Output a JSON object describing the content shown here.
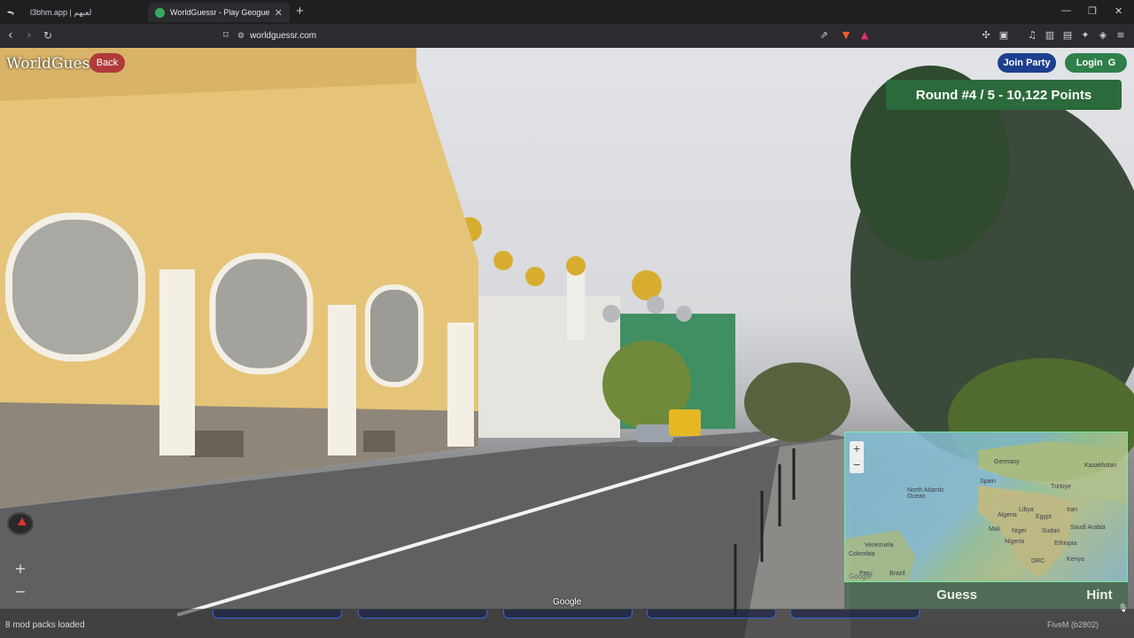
{
  "browser": {
    "tabs": [
      {
        "title": "l3bhm.app | لعبهم",
        "active": false
      },
      {
        "title": "WorldGuessr - Play Geoguessr fr",
        "active": true
      }
    ],
    "url": "worldguessr.com",
    "window_controls": [
      "—",
      "❐",
      "✕"
    ]
  },
  "game": {
    "logo": "WorldGuessr",
    "back_label": "Back",
    "join_party_label": "Join Party",
    "login_label": "Login",
    "login_icon": "G",
    "round_banner": "Round #4 / 5 - 10,122 Points",
    "guess_label": "Guess",
    "hint_label": "Hint",
    "streetview_zoom_in": "+",
    "streetview_zoom_out": "−",
    "map_zoom_in": "+",
    "map_zoom_out": "−",
    "google_watermark": "Google",
    "map_google_watermark": "Google",
    "map_labels": [
      "Germany",
      "Kazakhstan",
      "Spain",
      "Türkiye",
      "North Atlantic Ocean",
      "Egypt",
      "Iran",
      "Algeria",
      "Libya",
      "Saudi Arabia",
      "Mali",
      "Niger",
      "Sudan",
      "Nigeria",
      "Ethiopia",
      "Venezuela",
      "Colombia",
      "DRC",
      "Kenya",
      "Brazil",
      "Peru"
    ]
  },
  "footer": {
    "mod_packs": "8 mod packs loaded",
    "fivem": "FiveM (b2802)"
  },
  "colors": {
    "back_button": "#b03a3a",
    "join_party_button": "#1c3f8f",
    "login_button": "#2f7f4b",
    "round_banner": "#2b6a3b"
  }
}
